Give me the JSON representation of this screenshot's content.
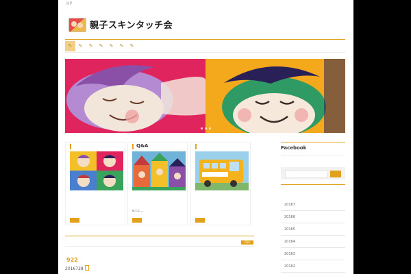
{
  "header": {
    "hp_label": "HP",
    "site_title": "親子スキンタッチ会"
  },
  "nav": {
    "items": [
      "✎",
      "✎",
      "✎",
      "✎",
      "✎",
      "✎",
      "✎"
    ],
    "active_index": 0
  },
  "slider": {
    "dot_count": 3
  },
  "cards": [
    {
      "title": "",
      "text": ""
    },
    {
      "title": "Q&A",
      "text": "e.t.c..."
    },
    {
      "title": "",
      "text": ""
    }
  ],
  "rss_label": "RSS",
  "post": {
    "title": "922",
    "date": "2016728"
  },
  "sidebar": {
    "facebook_title": "Facebook",
    "archives": [
      "20167",
      "20166",
      "20165",
      "20164",
      "20163",
      "20162"
    ]
  },
  "colors": {
    "accent": "#e2a01b",
    "nav_active": "#f3d08a",
    "background": "#000000"
  }
}
